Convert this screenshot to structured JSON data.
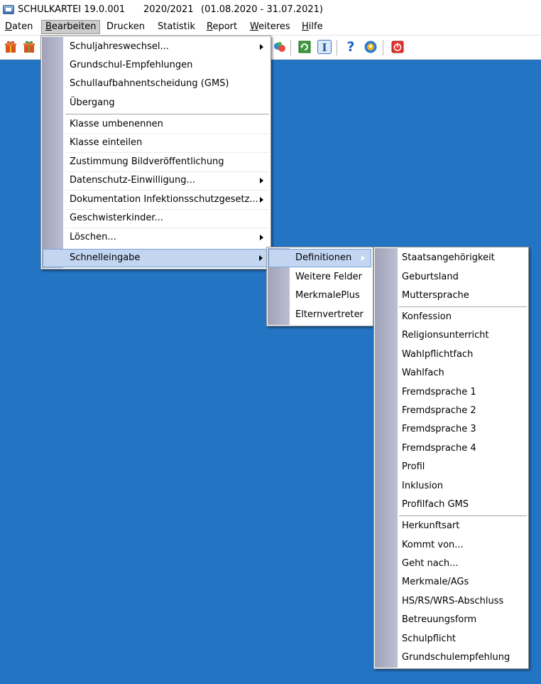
{
  "titlebar": {
    "app_name": "SCHULKARTEI 19.0.001",
    "school_year": "2020/2021",
    "date_range": "(01.08.2020 - 31.07.2021)"
  },
  "menubar": {
    "daten": {
      "pre": "",
      "u": "D",
      "post": "aten"
    },
    "bearbeiten": {
      "pre": "",
      "u": "B",
      "post": "earbeiten"
    },
    "drucken": "Drucken",
    "statistik": "Statistik",
    "report": {
      "pre": "",
      "u": "R",
      "post": "eport"
    },
    "weiteres": {
      "pre": "",
      "u": "W",
      "post": "eiteres"
    },
    "hilfe": {
      "pre": "",
      "u": "H",
      "post": "ilfe"
    }
  },
  "toolbar": {
    "help_glyph": "?",
    "info_glyph": "I"
  },
  "bearbeiten_menu": {
    "items": [
      "Schuljahreswechsel...",
      "Grundschul-Empfehlungen",
      "Schullaufbahnentscheidung (GMS)",
      "Übergang",
      "Klasse umbenennen",
      "Klasse einteilen",
      "Zustimmung Bildveröffentlichung",
      "Datenschutz-Einwilligung...",
      "Dokumentation Infektionsschutzgesetz...",
      "Geschwisterkinder...",
      "Löschen...",
      "Schnelleingabe"
    ]
  },
  "schnelleingabe_menu": {
    "items": [
      "Definitionen",
      "Weitere Felder",
      "MerkmalePlus",
      "Elternvertreter"
    ]
  },
  "definitionen_menu": {
    "items": [
      "Staatsangehörigkeit",
      "Geburtsland",
      "Muttersprache",
      "Konfession",
      "Religionsunterricht",
      "Wahlpflichtfach",
      "Wahlfach",
      "Fremdsprache 1",
      "Fremdsprache 2",
      "Fremdsprache 3",
      "Fremdsprache 4",
      "Profil",
      "Inklusion",
      "Profilfach GMS",
      "Herkunftsart",
      "Kommt von...",
      "Geht nach...",
      "Merkmale/AGs",
      "HS/RS/WRS-Abschluss",
      "Betreuungsform",
      "Schulpflicht",
      "Grundschulempfehlung"
    ]
  },
  "colors": {
    "desktop": "#2474c4",
    "menu_gutter": "#a0a3b8",
    "highlight": "#c3d6f1",
    "highlight_border": "#7aa2d6"
  }
}
